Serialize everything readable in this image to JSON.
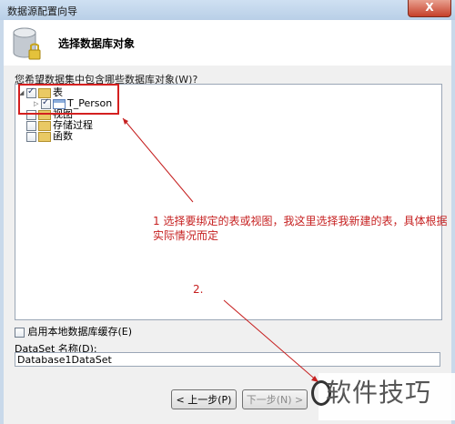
{
  "window": {
    "title": "数据源配置向导",
    "close_glyph": "X"
  },
  "header": {
    "title": "选择数据库对象",
    "icon": "database-icon"
  },
  "prompt": "您希望数据集中包含哪些数据库对象(W)?",
  "tree": {
    "tables": {
      "label": "表",
      "checked": true,
      "expanded": true
    },
    "tables_child": {
      "label": "T_Person",
      "checked": true
    },
    "views": {
      "label": "视图",
      "checked": false
    },
    "procs": {
      "label": "存储过程",
      "checked": false
    },
    "funcs": {
      "label": "函数",
      "checked": false
    }
  },
  "cache": {
    "label": "启用本地数据库缓存(E)",
    "checked": false
  },
  "dataset": {
    "label": "DataSet 名称(D):",
    "value": "Database1DataSet"
  },
  "buttons": {
    "prev": "< 上一步(P)",
    "next": "下一步(N) >"
  },
  "annotations": {
    "note1": "1  选择要绑定的表或视图，我这里选择我新建的表，具体根据实际情况而定",
    "note2": "2."
  },
  "watermark": {
    "text": "软件技巧"
  },
  "colors": {
    "annotation": "#c62020",
    "highlight": "#d42020"
  }
}
